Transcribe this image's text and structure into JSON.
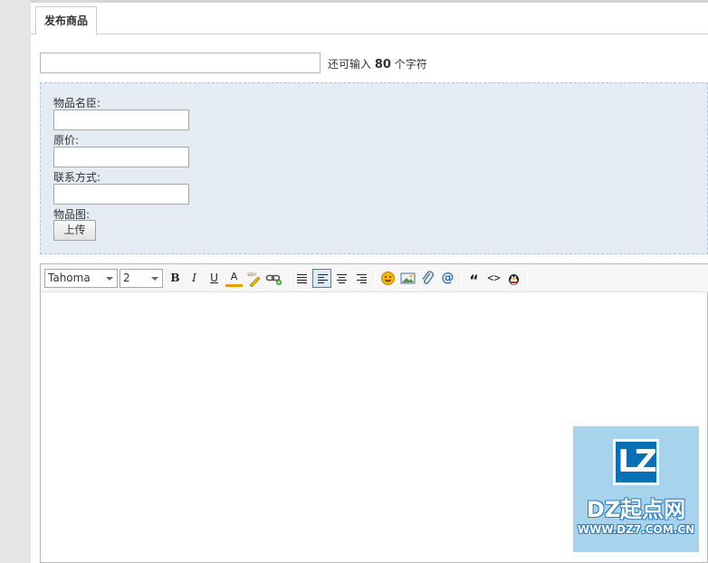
{
  "tab": {
    "label": "发布商品"
  },
  "subject": {
    "value": "",
    "hint_prefix": "还可输入",
    "hint_count": "80",
    "hint_suffix": "个字符"
  },
  "form": {
    "fields": [
      {
        "label": "物品名臣:",
        "value": ""
      },
      {
        "label": "原价:",
        "value": ""
      },
      {
        "label": "联系方式:",
        "value": ""
      }
    ],
    "image_label": "物品图:",
    "upload_label": "上传"
  },
  "toolbar": {
    "font": "Tahoma",
    "size": "2",
    "bold": "B",
    "italic": "I",
    "underline": "U",
    "forecolor": "A",
    "spell": "abc",
    "quote": "“",
    "code": "<>"
  },
  "watermark": {
    "logo": "LZ",
    "name": "DZ起点网",
    "url": "WWW.DZ7.COM.CN"
  },
  "colors": {
    "panel_bg": "#e5ebf2",
    "accent": "#0b6fb6"
  }
}
